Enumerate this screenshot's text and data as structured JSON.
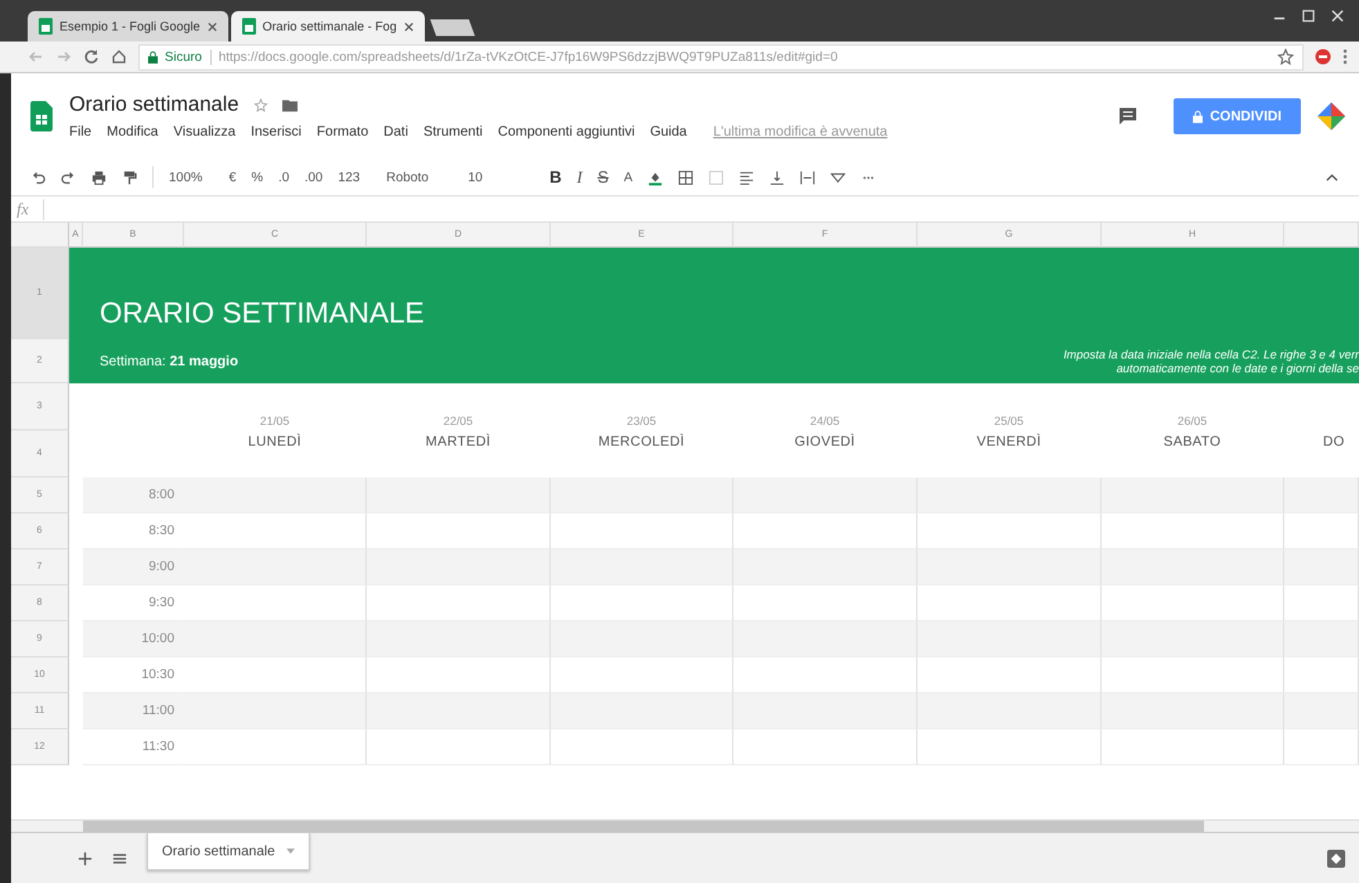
{
  "browser": {
    "tabs": [
      {
        "title": "Esempio 1 - Fogli Google",
        "selected": false
      },
      {
        "title": "Orario settimanale - Fog",
        "selected": true
      }
    ],
    "secure_label": "Sicuro",
    "url": "https://docs.google.com/spreadsheets/d/1rZa-tVKzOtCE-J7fp16W9PS6dzzjBWQ9T9PUZa811s/edit#gid=0"
  },
  "document": {
    "title": "Orario settimanale",
    "menus": [
      "File",
      "Modifica",
      "Visualizza",
      "Inserisci",
      "Formato",
      "Dati",
      "Strumenti",
      "Componenti aggiuntivi",
      "Guida"
    ],
    "last_edit": "L'ultima modifica è avvenuta",
    "share_button": "CONDIVIDI"
  },
  "toolbar": [
    {
      "label": "100%",
      "kind": "dropdown"
    },
    {
      "label": "€",
      "kind": "button"
    },
    {
      "label": "%",
      "kind": "button"
    },
    {
      "label": ".0",
      "kind": "button"
    },
    {
      "label": ".00",
      "kind": "button"
    },
    {
      "label": "123",
      "kind": "dropdown"
    },
    {
      "label": "Roboto",
      "kind": "font"
    },
    {
      "label": "10",
      "kind": "font"
    },
    {
      "label": "B",
      "kind": "bold"
    },
    {
      "label": "I",
      "kind": "italic"
    },
    {
      "label": "S",
      "kind": "strike"
    },
    {
      "label": "A",
      "kind": "button"
    }
  ],
  "formula_bar": {
    "label": "fx"
  },
  "columns": [
    "A",
    "B",
    "C",
    "D",
    "E",
    "F",
    "G",
    "H"
  ],
  "row_numbers": [
    "1",
    "2",
    "3",
    "4",
    "5",
    "6",
    "7",
    "8",
    "9",
    "10",
    "11",
    "12"
  ],
  "banner": {
    "title": "ORARIO SETTIMANALE",
    "subtitle": "Settimana: **21 maggio**",
    "note": [
      "Imposta la data iniziale nella cella C2. Le righe 3 e 4 verr",
      "automaticamente con le date e i giorni della se"
    ]
  },
  "days": [
    {
      "date": "21/05",
      "name": "LUNEDÌ"
    },
    {
      "date": "22/05",
      "name": "MARTEDÌ"
    },
    {
      "date": "23/05",
      "name": "MERCOLEDÌ"
    },
    {
      "date": "24/05",
      "name": "GIOVEDÌ"
    },
    {
      "date": "25/05",
      "name": "VENERDÌ"
    },
    {
      "date": "26/05",
      "name": "SABATO"
    },
    {
      "name": "DO"
    }
  ],
  "times": [
    "8:00",
    "8:30",
    "9:00",
    "9:30",
    "10:00",
    "10:30",
    "11:00",
    "11:30"
  ],
  "sheet_tabs": [
    {
      "label": "Orario settimanale",
      "selected": true
    }
  ]
}
